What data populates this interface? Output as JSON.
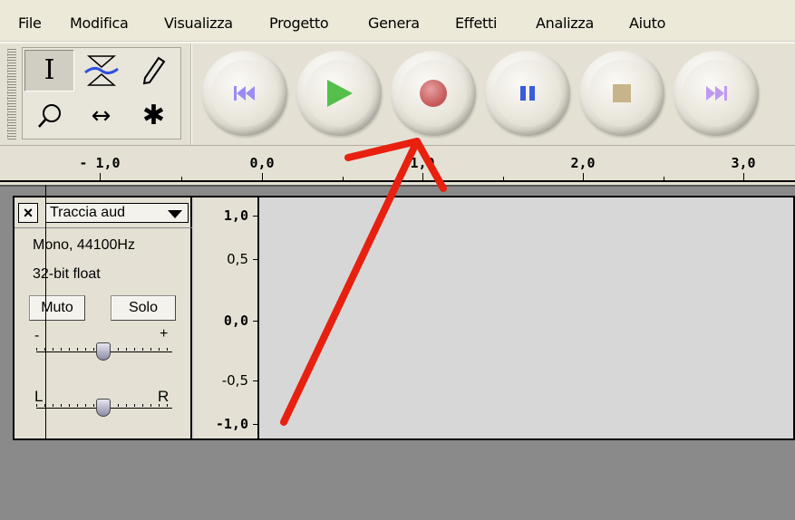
{
  "menu": [
    "File",
    "Modifica",
    "Visualizza",
    "Progetto",
    "Genera",
    "Effetti",
    "Analizza",
    "Aiuto"
  ],
  "tools": [
    {
      "name": "selection-tool",
      "glyph": "I"
    },
    {
      "name": "envelope-tool",
      "glyph": ""
    },
    {
      "name": "draw-tool",
      "glyph": "✎"
    },
    {
      "name": "zoom-tool",
      "glyph": "⚲"
    },
    {
      "name": "timeshift-tool",
      "glyph": "↔"
    },
    {
      "name": "multi-tool",
      "glyph": "✱"
    }
  ],
  "transport": [
    {
      "name": "skip-to-start-button",
      "icon": "skip-start-icon",
      "color": "#9a8cf0"
    },
    {
      "name": "play-button",
      "icon": "play-icon",
      "color": "#54c04a"
    },
    {
      "name": "record-button",
      "icon": "record-icon",
      "color": "#cc7070"
    },
    {
      "name": "pause-button",
      "icon": "pause-icon",
      "color": "#3a5cdc"
    },
    {
      "name": "stop-button",
      "icon": "stop-icon",
      "color": "#c8b48a"
    },
    {
      "name": "skip-to-end-button",
      "icon": "skip-end-icon",
      "color": "#c09af0"
    }
  ],
  "ruler": {
    "labels": [
      "- 1,0",
      "0,0",
      "1,0",
      "2,0",
      "3,0"
    ]
  },
  "track": {
    "name": "Traccia aud",
    "format": "Mono, 44100Hz",
    "bit_depth": "32-bit float",
    "mute_label": "Muto",
    "solo_label": "Solo",
    "gain_minus": "-",
    "gain_plus": "+",
    "pan_left": "L",
    "pan_right": "R"
  },
  "scale": {
    "labels": [
      "1,0",
      "0,5",
      "0,0",
      "-0,5",
      "-1,0"
    ]
  },
  "annotation": {
    "color": "#e82010"
  }
}
